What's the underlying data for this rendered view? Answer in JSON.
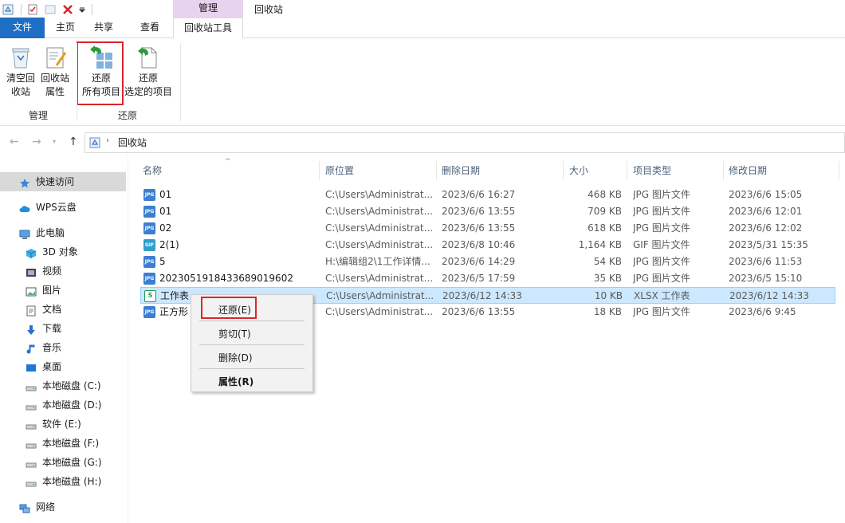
{
  "window": {
    "context_tab_header": "管理",
    "title": "回收站"
  },
  "tabs": {
    "file": "文件",
    "home": "主页",
    "share": "共享",
    "view": "查看",
    "tools": "回收站工具"
  },
  "ribbon": {
    "empty_bin_line1": "清空回",
    "empty_bin_line2": "收站",
    "bin_props_line1": "回收站",
    "bin_props_line2": "属性",
    "restore_all_line1": "还原",
    "restore_all_line2": "所有项目",
    "restore_selected_line1": "还原",
    "restore_selected_line2": "选定的项目",
    "group_manage": "管理",
    "group_restore": "还原"
  },
  "address": {
    "path": "回收站"
  },
  "sidebar": {
    "items": [
      {
        "label": "快速访问",
        "icon": "star-icon"
      },
      {
        "label": "WPS云盘",
        "icon": "cloud-icon"
      },
      {
        "label": "此电脑",
        "icon": "computer-icon"
      },
      {
        "label": "3D 对象",
        "icon": "cube-icon"
      },
      {
        "label": "视频",
        "icon": "video-icon"
      },
      {
        "label": "图片",
        "icon": "picture-icon"
      },
      {
        "label": "文档",
        "icon": "document-icon"
      },
      {
        "label": "下载",
        "icon": "download-icon"
      },
      {
        "label": "音乐",
        "icon": "music-icon"
      },
      {
        "label": "桌面",
        "icon": "desktop-icon"
      },
      {
        "label": "本地磁盘 (C:)",
        "icon": "drive-icon"
      },
      {
        "label": "本地磁盘 (D:)",
        "icon": "drive-icon"
      },
      {
        "label": "软件 (E:)",
        "icon": "drive-icon"
      },
      {
        "label": "本地磁盘 (F:)",
        "icon": "drive-icon"
      },
      {
        "label": "本地磁盘 (G:)",
        "icon": "drive-icon"
      },
      {
        "label": "本地磁盘 (H:)",
        "icon": "drive-icon"
      },
      {
        "label": "网络",
        "icon": "network-icon"
      }
    ]
  },
  "columns": {
    "name": "名称",
    "original_location": "原位置",
    "date_deleted": "删除日期",
    "size": "大小",
    "item_type": "项目类型",
    "date_modified": "修改日期"
  },
  "files": [
    {
      "name": "01",
      "icon": "JPG",
      "location": "C:\\Users\\Administrat...",
      "deleted": "2023/6/6 16:27",
      "size": "468 KB",
      "type": "JPG 图片文件",
      "modified": "2023/6/6 15:05"
    },
    {
      "name": "01",
      "icon": "JPG",
      "location": "C:\\Users\\Administrat...",
      "deleted": "2023/6/6 13:55",
      "size": "709 KB",
      "type": "JPG 图片文件",
      "modified": "2023/6/6 12:01"
    },
    {
      "name": "02",
      "icon": "JPG",
      "location": "C:\\Users\\Administrat...",
      "deleted": "2023/6/6 13:55",
      "size": "618 KB",
      "type": "JPG 图片文件",
      "modified": "2023/6/6 12:02"
    },
    {
      "name": "2(1)",
      "icon": "GIF",
      "location": "C:\\Users\\Administrat...",
      "deleted": "2023/6/8 10:46",
      "size": "1,164 KB",
      "type": "GIF 图片文件",
      "modified": "2023/5/31 15:35"
    },
    {
      "name": "5",
      "icon": "JPG",
      "location": "H:\\编辑组2\\1工作详情...",
      "deleted": "2023/6/6 14:29",
      "size": "54 KB",
      "type": "JPG 图片文件",
      "modified": "2023/6/6 11:53"
    },
    {
      "name": "20230519184336890196​02",
      "icon": "JPG",
      "location": "C:\\Users\\Administrat...",
      "deleted": "2023/6/5 17:59",
      "size": "35 KB",
      "type": "JPG 图片文件",
      "modified": "2023/6/5 15:10"
    },
    {
      "name": "工作表",
      "icon": "XLSX",
      "location": "C:\\Users\\Administrat...",
      "deleted": "2023/6/12 14:33",
      "size": "10 KB",
      "type": "XLSX 工作表",
      "modified": "2023/6/12 14:33"
    },
    {
      "name": "正方形",
      "icon": "JPG",
      "location": "C:\\Users\\Administrat...",
      "deleted": "2023/6/6 13:55",
      "size": "18 KB",
      "type": "JPG 图片文件",
      "modified": "2023/6/6 9:45"
    }
  ],
  "context_menu": {
    "restore": "还原(E)",
    "cut": "剪切(T)",
    "delete": "删除(D)",
    "properties": "属性(R)"
  },
  "colors": {
    "file_tab": "#1e6ec3",
    "context_tab": "#e8d3ef",
    "selection": "#cce8ff",
    "highlight": "#d9262c"
  }
}
